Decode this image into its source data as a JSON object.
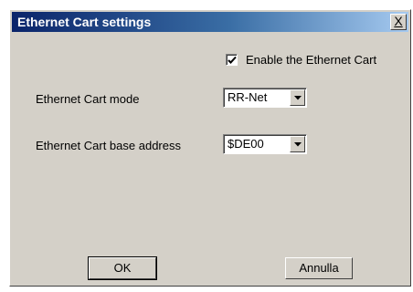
{
  "window": {
    "title": "Ethernet Cart settings",
    "close_label": "X"
  },
  "enable_checkbox": {
    "label": "Enable the Ethernet Cart",
    "checked": true
  },
  "mode": {
    "label": "Ethernet Cart mode",
    "value": "RR-Net"
  },
  "base_address": {
    "label": "Ethernet Cart base address",
    "value": "$DE00"
  },
  "buttons": {
    "ok": "OK",
    "cancel": "Annulla"
  },
  "colors": {
    "title_start": "#0a246a",
    "title_end": "#a6caf0",
    "dialog_face": "#d4d0c8"
  }
}
